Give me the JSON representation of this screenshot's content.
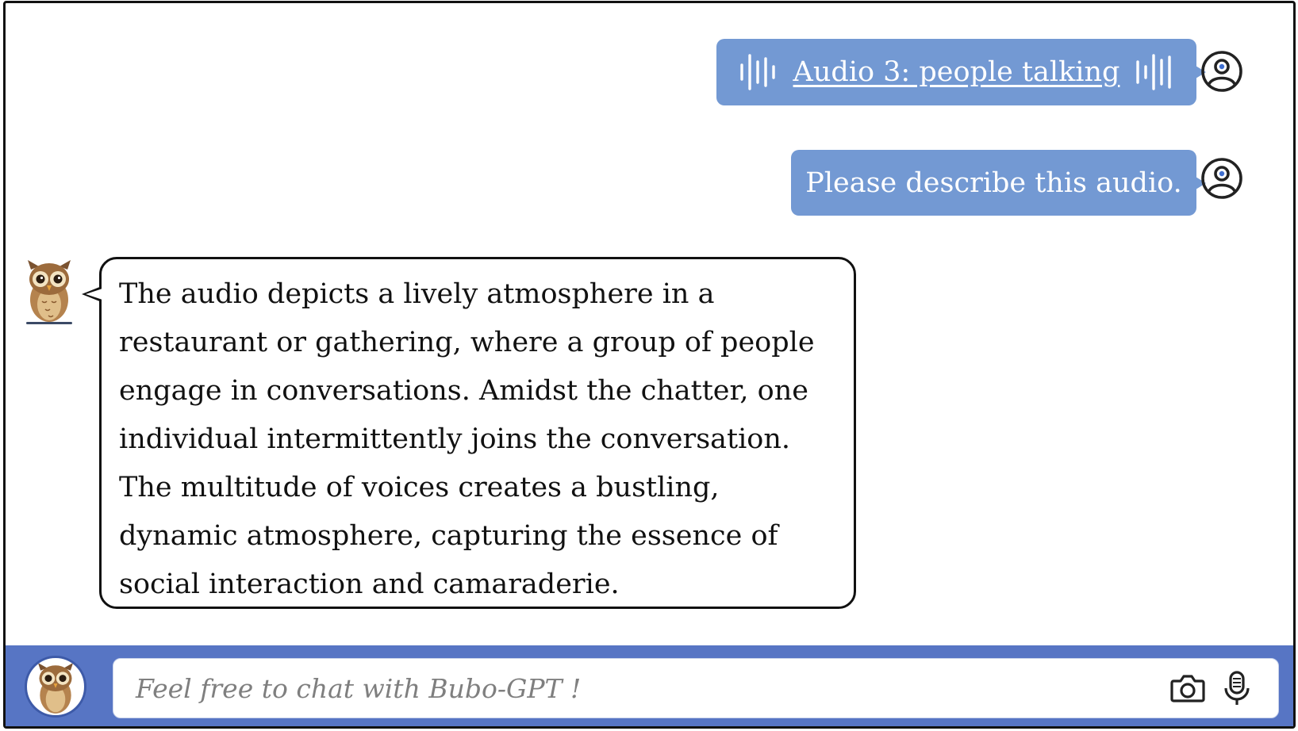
{
  "conversation": {
    "messages": [
      {
        "role": "user",
        "type": "audio",
        "label": "Audio 3: people talking"
      },
      {
        "role": "user",
        "type": "text",
        "text": "Please describe this audio."
      },
      {
        "role": "bot",
        "type": "text",
        "text": "The audio depicts a lively atmosphere in a restaurant or gathering, where a group of people engage in conversations. Amidst the chatter, one individual intermittently joins the conversation. The multitude of voices creates a bustling, dynamic atmosphere, capturing the essence of social interaction and camaraderie."
      }
    ]
  },
  "input": {
    "placeholder": "Feel free to chat with Bubo-GPT !",
    "icons": [
      "camera-icon",
      "microphone-icon"
    ]
  },
  "colors": {
    "user_bubble": "#7399d3",
    "input_bar": "#5775c4",
    "text": "#111111",
    "placeholder": "#7f7f7f"
  },
  "icons": {
    "user_avatar": "user-avatar-icon",
    "bot_avatar": "owl-icon",
    "audio_wave": "audio-wave-icon"
  }
}
